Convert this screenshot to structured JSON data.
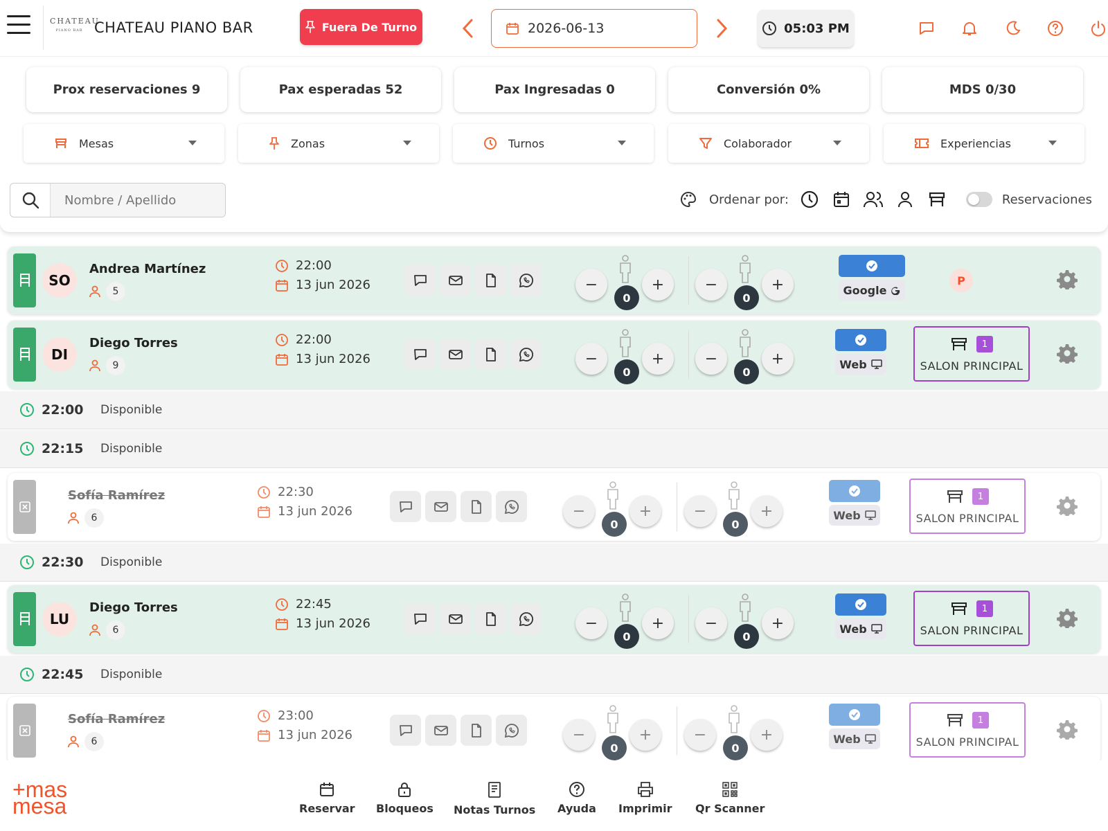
{
  "header": {
    "brand_logo_big": "CHATEAU",
    "brand_logo_small": "PIANO BAR",
    "venue_name": "CHATEAU PIANO BAR",
    "shift_button": "Fuera De Turno",
    "date": "2026-06-13",
    "time": "05:03 PM",
    "icons": [
      "chat-icon",
      "bell-icon",
      "moon-icon",
      "help-icon",
      "power-icon"
    ]
  },
  "stats": [
    "Prox reservaciones 9",
    "Pax esperadas 52",
    "Pax Ingresadas 0",
    "Conversión 0%",
    "MDS 0/30"
  ],
  "filters": [
    "Mesas",
    "Zonas",
    "Turnos",
    "Colaborador",
    "Experiencias"
  ],
  "search": {
    "placeholder": "Nombre / Apellido"
  },
  "sort": {
    "label": "Ordenar por:",
    "toggle_label": "Reservaciones"
  },
  "reservations": [
    {
      "initials": "SO",
      "name": "Andrea Martínez",
      "pax": "5",
      "time": "22:00",
      "date": "13 jun 2026",
      "count_a": "0",
      "count_b": "0",
      "source": "Google",
      "badge": "P",
      "cancelled": false
    },
    {
      "initials": "DI",
      "name": "Diego Torres",
      "pax": "9",
      "time": "22:00",
      "date": "13 jun 2026",
      "count_a": "0",
      "count_b": "0",
      "source": "Web",
      "table_num": "1",
      "zone": "SALON PRINCIPAL",
      "cancelled": false
    },
    {
      "initials": "",
      "name": "Sofía Ramírez",
      "pax": "6",
      "time": "22:30",
      "date": "13 jun 2026",
      "count_a": "0",
      "count_b": "0",
      "source": "Web",
      "table_num": "1",
      "zone": "SALON PRINCIPAL",
      "cancelled": true
    },
    {
      "initials": "LU",
      "name": "Diego Torres",
      "pax": "6",
      "time": "22:45",
      "date": "13 jun 2026",
      "count_a": "0",
      "count_b": "0",
      "source": "Web",
      "table_num": "1",
      "zone": "SALON PRINCIPAL",
      "cancelled": false
    },
    {
      "initials": "",
      "name": "Sofía Ramírez",
      "pax": "6",
      "time": "23:00",
      "date": "13 jun 2026",
      "count_a": "0",
      "count_b": "0",
      "source": "Web",
      "table_num": "1",
      "zone": "SALON PRINCIPAL",
      "cancelled": true
    }
  ],
  "slots": [
    {
      "time": "22:00",
      "status": "Disponible"
    },
    {
      "time": "22:15",
      "status": "Disponible"
    },
    {
      "time": "22:30",
      "status": "Disponible"
    },
    {
      "time": "22:45",
      "status": "Disponible"
    }
  ],
  "bottom_nav": {
    "logo_top": "+mas",
    "logo_bottom": "mesa",
    "items": [
      "Reservar",
      "Bloqueos",
      "Notas Turnos",
      "Ayuda",
      "Imprimir",
      "Qr Scanner"
    ]
  },
  "colors": {
    "accent": "#f06a3c",
    "danger": "#f03e4f",
    "green_row": "#e2f1e9",
    "green_tab": "#3aa86b",
    "zone_border": "#a23ec8",
    "source_blue": "#3b82d6"
  }
}
